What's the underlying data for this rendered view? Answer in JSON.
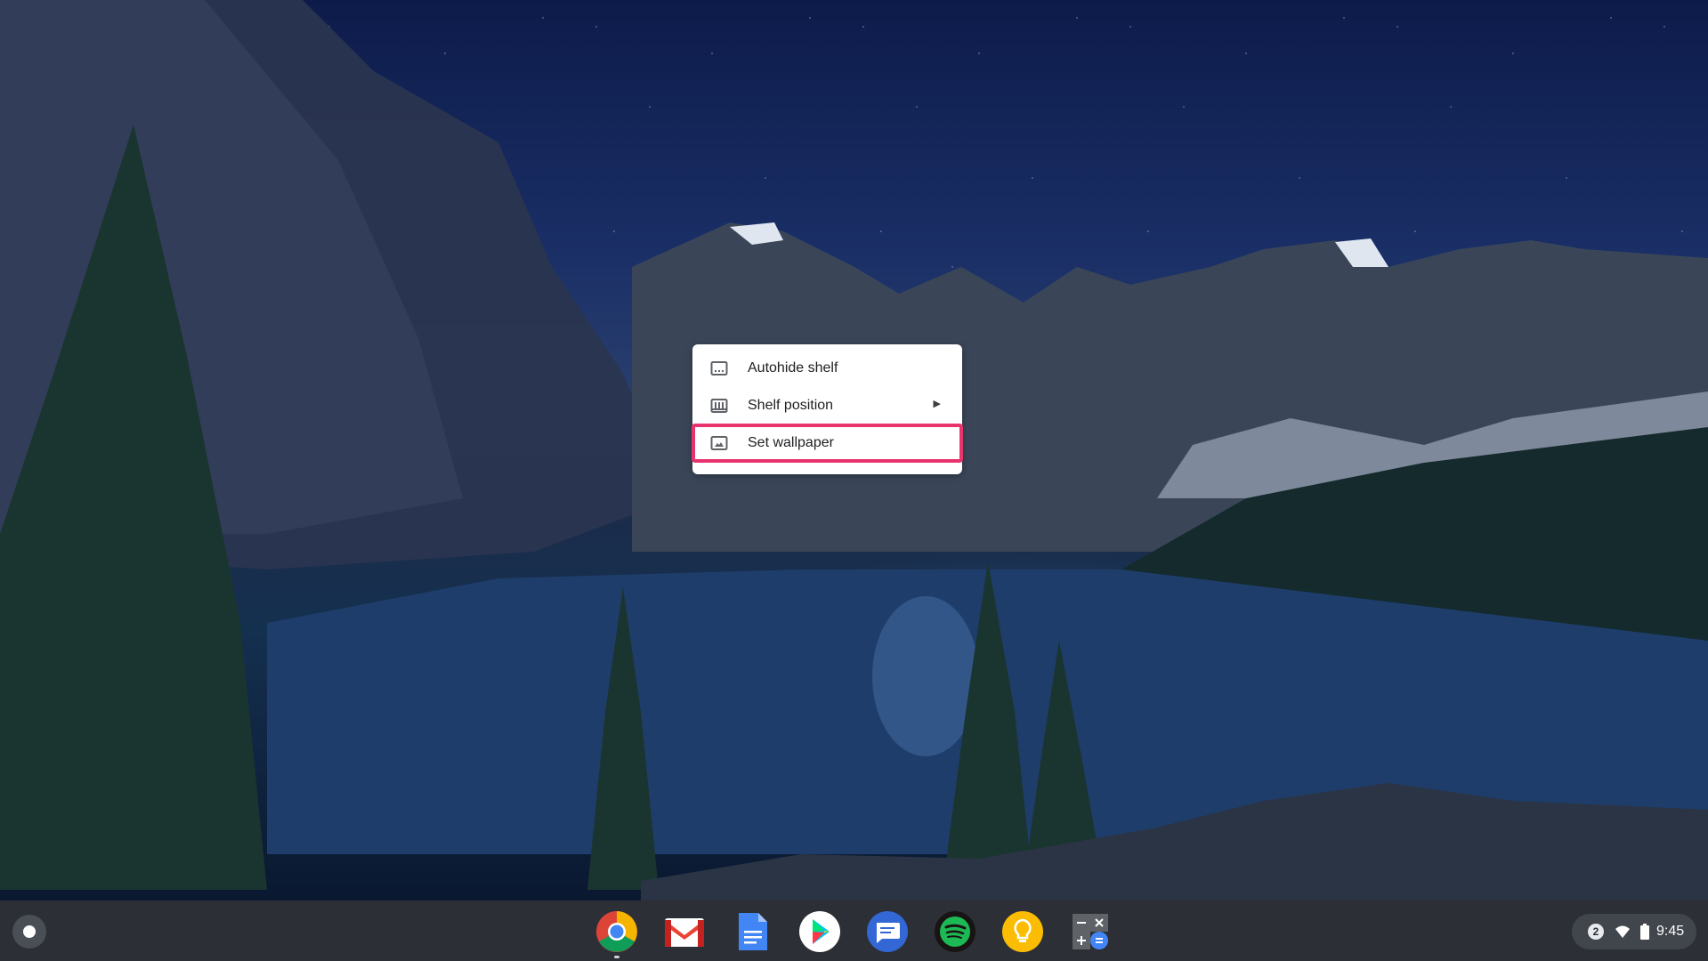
{
  "context_menu": {
    "items": [
      {
        "label": "Autohide shelf",
        "icon": "autohide-shelf-icon",
        "has_submenu": false
      },
      {
        "label": "Shelf position",
        "icon": "shelf-position-icon",
        "has_submenu": true
      },
      {
        "label": "Set wallpaper",
        "icon": "wallpaper-icon",
        "has_submenu": false,
        "highlighted": true
      }
    ],
    "highlight_color": "#e8336d"
  },
  "shelf": {
    "launcher_icon": "launcher-icon",
    "apps": [
      {
        "name": "chrome-icon",
        "running": true
      },
      {
        "name": "gmail-icon",
        "running": false
      },
      {
        "name": "docs-icon",
        "running": false
      },
      {
        "name": "play-store-icon",
        "running": false
      },
      {
        "name": "messages-icon",
        "running": false
      },
      {
        "name": "spotify-icon",
        "running": false
      },
      {
        "name": "keep-icon",
        "running": false
      },
      {
        "name": "calculator-icon",
        "running": false
      }
    ],
    "status": {
      "notification_count": "2",
      "wifi_icon": "wifi-icon",
      "battery_icon": "battery-icon",
      "time": "9:45"
    }
  }
}
